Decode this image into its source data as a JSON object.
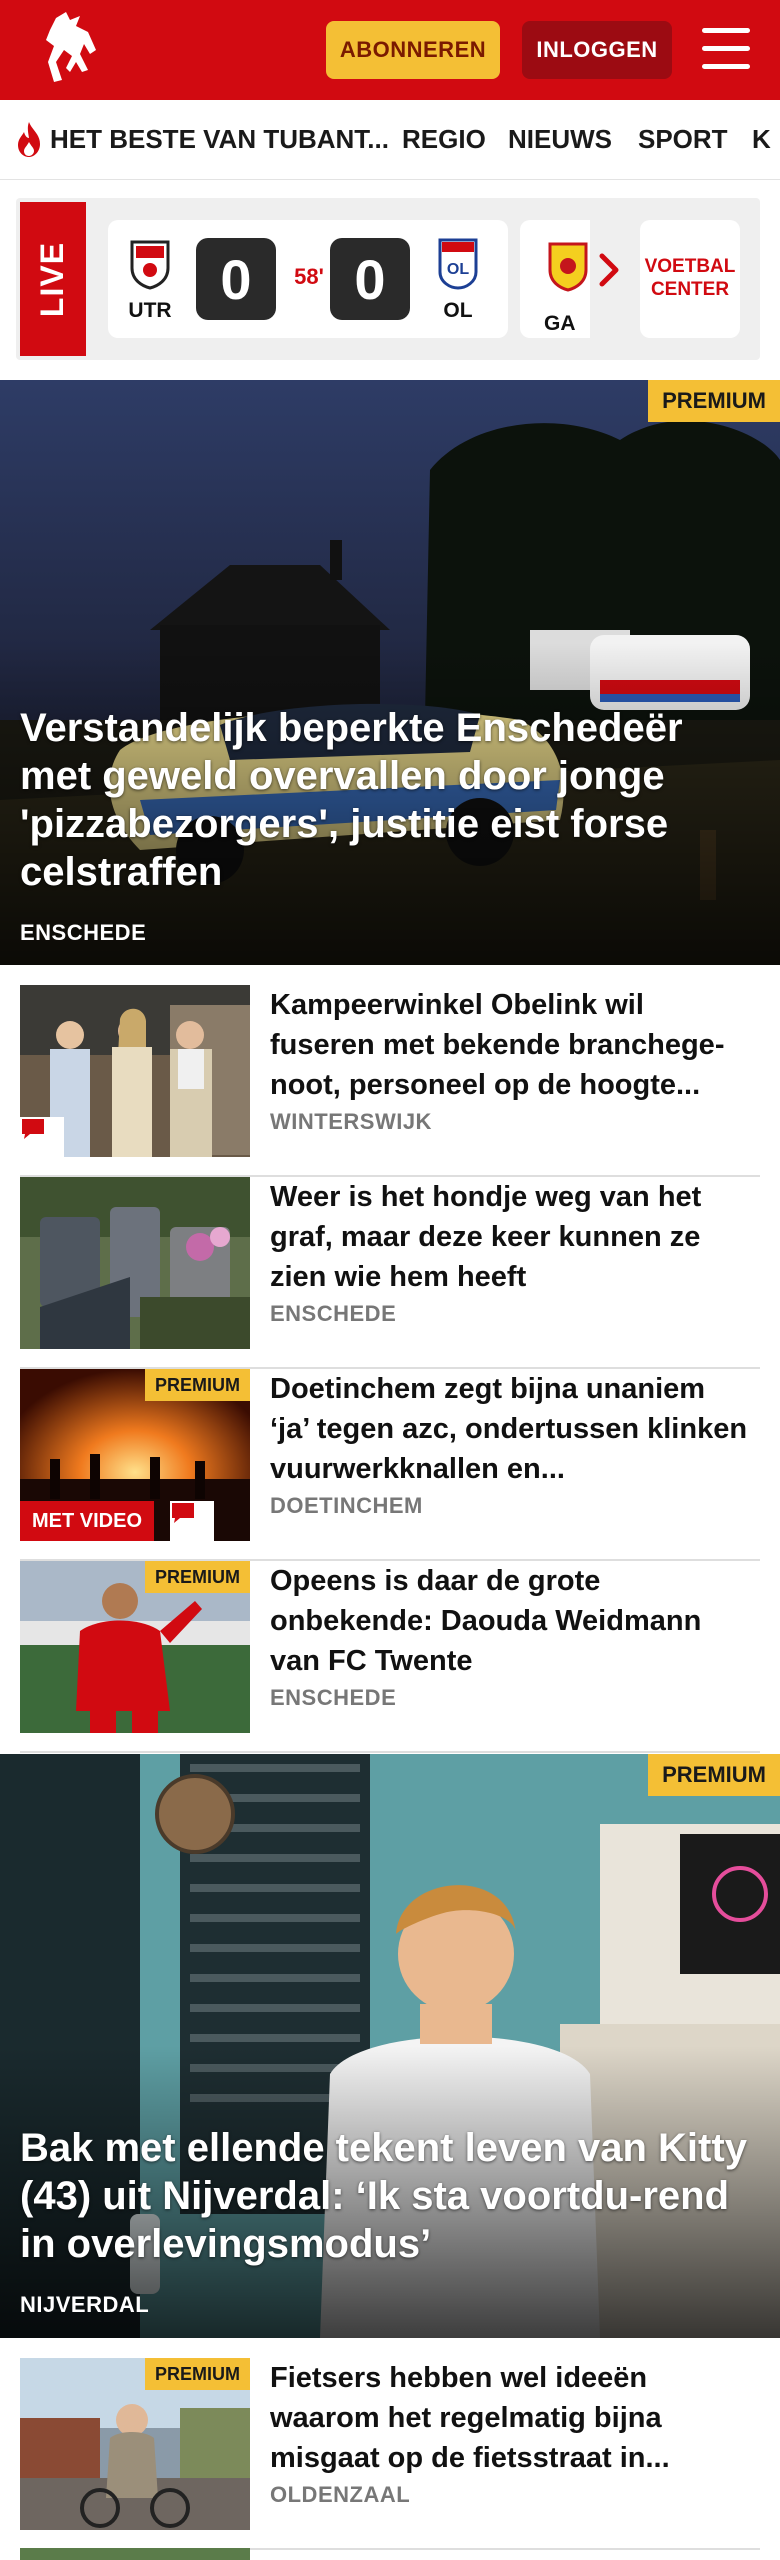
{
  "colors": {
    "brand_red": "#d10a11",
    "premium_yellow": "#f4bf35",
    "dark_red": "#9c0b12"
  },
  "header": {
    "logo_icon": "tubantia-horse-logo",
    "subscribe_label": "ABONNEREN",
    "login_label": "INLOGGEN",
    "menu_icon": "hamburger-menu-icon"
  },
  "nav": {
    "items": [
      {
        "label": "HET BESTE VAN TUBANT...",
        "icon": "flame-icon"
      },
      {
        "label": "REGIO"
      },
      {
        "label": "NIEUWS"
      },
      {
        "label": "SPORT"
      },
      {
        "label": "K"
      }
    ]
  },
  "live": {
    "label": "LIVE",
    "match": {
      "home": "UTR",
      "away": "OL",
      "home_score": "0",
      "away_score": "0",
      "minute": "58'"
    },
    "next_match_team": "GA",
    "voetbal_center_line1": "VOETBAL",
    "voetbal_center_line2": "CENTER"
  },
  "articles": {
    "hero1": {
      "premium": "PREMIUM",
      "title": "Verstandelijk beperkte Enschedeër met geweld overvallen door jonge 'pizzabezorgers', justitie eist forse celstraffen",
      "location": "ENSCHEDE"
    },
    "list1": [
      {
        "title": "Kampeerwinkel Obelink wil fuseren met bekende branchege-noot, personeel op de hoogte...",
        "location": "WINTERSWIJK",
        "comments": true
      },
      {
        "title": "Weer is het hondje weg van het graf, maar deze keer kunnen ze zien wie hem heeft",
        "location": "ENSCHEDE"
      },
      {
        "title": "Doetinchem zegt bijna unaniem ‘ja’ tegen azc, ondertussen klinken vuurwerkknallen en...",
        "location": "DOETINCHEM",
        "premium": "PREMIUM",
        "video": "MET VIDEO",
        "comments": true
      },
      {
        "title": "Opeens is daar de grote onbekende: Daouda Weidmann van FC Twente",
        "location": "ENSCHEDE",
        "premium": "PREMIUM"
      }
    ],
    "hero2": {
      "premium": "PREMIUM",
      "title": "Bak met ellende tekent leven van Kitty (43) uit Nijverdal: ‘Ik sta voortdu-rend in overlevingsmodus’",
      "location": "NIJVERDAL"
    },
    "list2": [
      {
        "title": "Fietsers hebben wel ideeën waarom het regelmatig bijna misgaat op de fietsstraat in...",
        "location": "OLDENZAAL",
        "premium": "PREMIUM"
      }
    ]
  }
}
